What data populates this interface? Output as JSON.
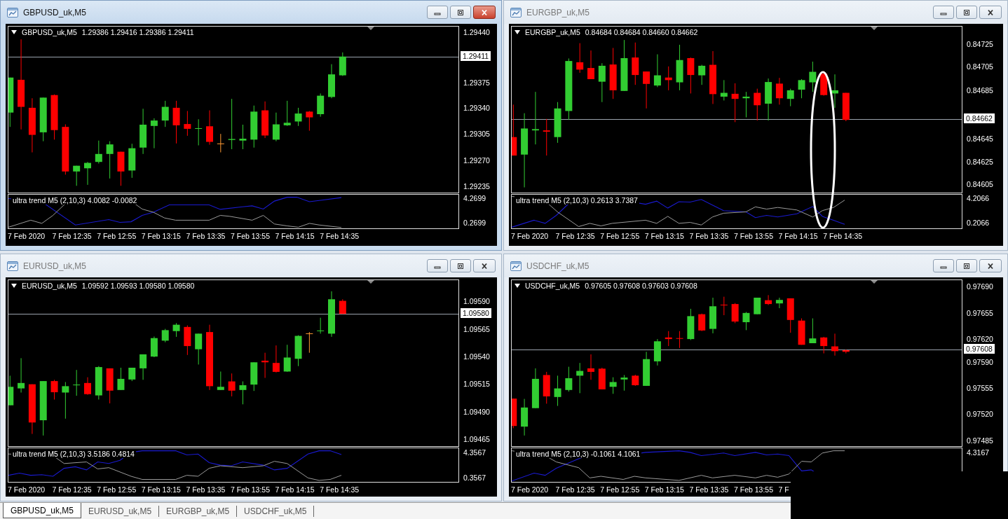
{
  "windows": [
    {
      "title": "GBPUSD_uk,M5",
      "active": true,
      "ellipse_mark": false,
      "chart": {
        "symbol": "GBPUSD_uk,M5",
        "ohlc": "1.29386 1.29416 1.29386 1.29411",
        "price_ticks": [
          "1.29440",
          "1.29375",
          "1.29340",
          "1.29305",
          "1.29270",
          "1.29235"
        ],
        "last_price": "1.29411",
        "indicator": "ultra trend M5 (2,10,3) 4.0082 -0.0082",
        "indicator_ticks": [
          "4.2699",
          "0.2699"
        ],
        "time_labels": [
          "7 Feb 2020",
          "7 Feb 12:35",
          "7 Feb 12:55",
          "7 Feb 13:15",
          "7 Feb 13:35",
          "7 Feb 13:55",
          "7 Feb 14:15",
          "7 Feb 14:35"
        ]
      }
    },
    {
      "title": "EURGBP_uk,M5",
      "active": false,
      "ellipse_mark": true,
      "chart": {
        "symbol": "EURGBP_uk,M5",
        "ohlc": "0.84684 0.84684 0.84660 0.84662",
        "price_ticks": [
          "0.84725",
          "0.84705",
          "0.84685",
          "0.84645",
          "0.84625",
          "0.84605"
        ],
        "last_price": "0.84662",
        "indicator": "ultra trend M5 (2,10,3) 0.2613 3.7387",
        "indicator_ticks": [
          "4.2066",
          "0.2066"
        ],
        "time_labels": [
          "7 Feb 2020",
          "7 Feb 12:35",
          "7 Feb 12:55",
          "7 Feb 13:15",
          "7 Feb 13:35",
          "7 Feb 13:55",
          "7 Feb 14:15",
          "7 Feb 14:35"
        ]
      }
    },
    {
      "title": "EURUSD_uk,M5",
      "active": false,
      "ellipse_mark": false,
      "chart": {
        "symbol": "EURUSD_uk,M5",
        "ohlc": "1.09592 1.09593 1.09580 1.09580",
        "price_ticks": [
          "1.09590",
          "1.09565",
          "1.09540",
          "1.09515",
          "1.09490",
          "1.09465"
        ],
        "last_price": "1.09580",
        "indicator": "ultra trend M5 (2,10,3) 3.5186 0.4814",
        "indicator_ticks": [
          "4.3567",
          "0.3567"
        ],
        "time_labels": [
          "7 Feb 2020",
          "7 Feb 12:35",
          "7 Feb 12:55",
          "7 Feb 13:15",
          "7 Feb 13:35",
          "7 Feb 13:55",
          "7 Feb 14:15",
          "7 Feb 14:35"
        ]
      }
    },
    {
      "title": "USDCHF_uk,M5",
      "active": false,
      "ellipse_mark": false,
      "chart": {
        "symbol": "USDCHF_uk,M5",
        "ohlc": "0.97605 0.97608 0.97603 0.97608",
        "price_ticks": [
          "0.97690",
          "0.97655",
          "0.97620",
          "0.97590",
          "0.97555",
          "0.97520",
          "0.97485"
        ],
        "last_price": "0.97608",
        "indicator": "ultra trend M5 (2,10,3) -0.1061 4.1061",
        "indicator_ticks": [
          "4.3167"
        ],
        "time_labels": [
          "7 Feb 2020",
          "7 Feb 12:35",
          "7 Feb 12:55",
          "7 Feb 13:15",
          "7 Feb 13:35",
          "7 Feb 13:55",
          "7 F"
        ]
      }
    }
  ],
  "tabs": [
    {
      "label": "GBPUSD_uk,M5",
      "selected": true
    },
    {
      "label": "EURUSD_uk,M5",
      "selected": false
    },
    {
      "label": "EURGBP_uk,M5",
      "selected": false
    },
    {
      "label": "USDCHF_uk,M5",
      "selected": false
    }
  ]
}
